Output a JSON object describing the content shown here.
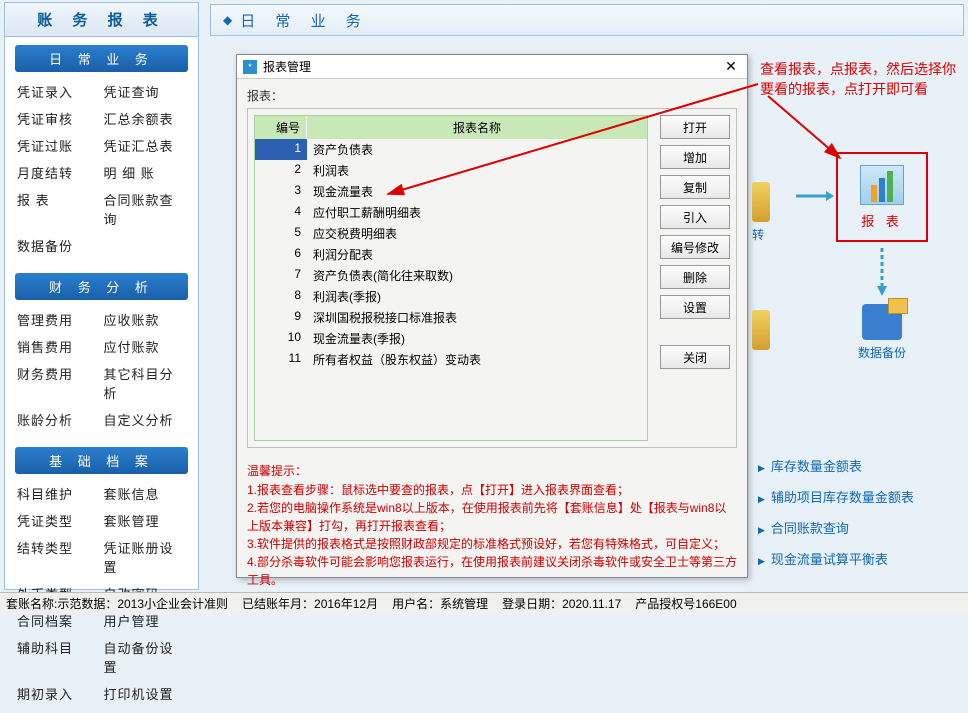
{
  "sidebar": {
    "title": "账 务 报 表",
    "sections": [
      {
        "header": "日 常 业 务",
        "rows": [
          [
            "凭证录入",
            "凭证查询"
          ],
          [
            "凭证审核",
            "汇总余额表"
          ],
          [
            "凭证过账",
            "凭证汇总表"
          ],
          [
            "月度结转",
            "明  细  账"
          ],
          [
            "报    表",
            "合同账款查询"
          ],
          [
            "数据备份",
            ""
          ]
        ]
      },
      {
        "header": "财 务 分 析",
        "rows": [
          [
            "管理费用",
            "应收账款"
          ],
          [
            "销售费用",
            "应付账款"
          ],
          [
            "财务费用",
            "其它科目分析"
          ],
          [
            "账龄分析",
            "自定义分析"
          ]
        ]
      },
      {
        "header": "基 础 档 案",
        "rows": [
          [
            "科目维护",
            "套账信息"
          ],
          [
            "凭证类型",
            "套账管理"
          ],
          [
            "结转类型",
            "凭证账册设置"
          ],
          [
            "外币类型",
            "自改密码"
          ],
          [
            "合同档案",
            "用户管理"
          ],
          [
            "辅助科目",
            "自动备份设置"
          ],
          [
            "期初录入",
            "打印机设置"
          ]
        ]
      }
    ]
  },
  "main_header": "日 常 业 务",
  "dialog": {
    "title": "报表管理",
    "fieldset_label": "报表：",
    "columns": {
      "num": "编号",
      "name": "报表名称"
    },
    "rows": [
      {
        "n": "1",
        "name": "资产负债表"
      },
      {
        "n": "2",
        "name": "利润表"
      },
      {
        "n": "3",
        "name": "现金流量表"
      },
      {
        "n": "4",
        "name": "应付职工薪酬明细表"
      },
      {
        "n": "5",
        "name": "应交税费明细表"
      },
      {
        "n": "6",
        "name": "利润分配表"
      },
      {
        "n": "7",
        "name": "资产负债表(简化往来取数)"
      },
      {
        "n": "8",
        "name": "利润表(季报)"
      },
      {
        "n": "9",
        "name": "深圳国税报税接口标准报表"
      },
      {
        "n": "10",
        "name": "现金流量表(季报)"
      },
      {
        "n": "11",
        "name": "所有者权益（股东权益）变动表"
      }
    ],
    "buttons": [
      "打开",
      "增加",
      "复制",
      "引入",
      "编号修改",
      "删除",
      "设置",
      "关闭"
    ],
    "tip_label": "温馨提示：",
    "tips": [
      "1.报表查看步骤：鼠标选中要查的报表，点【打开】进入报表界面查看；",
      "2.若您的电脑操作系统是win8以上版本，在使用报表前先将【套账信息】处【报表与win8以上版本兼容】打勾，再打开报表查看；",
      "3.软件提供的报表格式是按照财政部规定的标准格式预设好，若您有特殊格式，可自定义；",
      "4.部分杀毒软件可能会影响您报表运行，在使用报表前建议关闭杀毒软件或安全卫士等第三方工具。"
    ]
  },
  "annotation": "查看报表，点报表，然后选择你要看的报表，点打开即可看",
  "report_icon_label": "报  表",
  "backup_label": "数据备份",
  "side_label_a": "转",
  "links": [
    "库存数量金额表",
    "辅助项目库存数量金额表",
    "合同账款查询",
    "现金流量试算平衡表"
  ],
  "status": {
    "s1": "套账名称:示范数据：2013小企业会计准则",
    "s2": "已结账年月：2016年12月",
    "s3": "用户名：系统管理",
    "s4": "登录日期：2020.11.17",
    "s5": "产品授权号166E00"
  }
}
